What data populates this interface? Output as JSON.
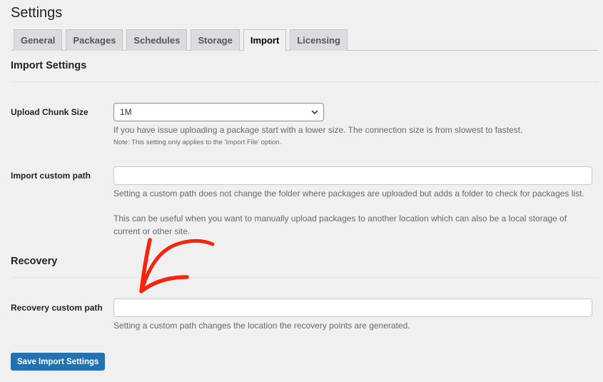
{
  "page": {
    "title": "Settings"
  },
  "tabs": [
    {
      "label": "General",
      "active": false
    },
    {
      "label": "Packages",
      "active": false
    },
    {
      "label": "Schedules",
      "active": false
    },
    {
      "label": "Storage",
      "active": false
    },
    {
      "label": "Import",
      "active": true
    },
    {
      "label": "Licensing",
      "active": false
    }
  ],
  "import_settings": {
    "heading": "Import Settings",
    "upload_chunk_size": {
      "label": "Upload Chunk Size",
      "selected": "1M",
      "description": "If you have issue uploading a package start with a lower size. The connection size is from slowest to fastest.",
      "note": "Note: This setting only applies to the 'Import File' option."
    },
    "import_custom_path": {
      "label": "Import custom path",
      "value": "",
      "description_1": "Setting a custom path does not change the folder where packages are uploaded but adds a folder to check for packages list.",
      "description_2": "This can be useful when you want to manually upload packages to another location which can also be a local storage of current or other site."
    }
  },
  "recovery": {
    "heading": "Recovery",
    "recovery_custom_path": {
      "label": "Recovery custom path",
      "value": "",
      "description": "Setting a custom path changes the location the recovery points are generated."
    }
  },
  "actions": {
    "save_label": "Save Import Settings"
  },
  "annotation": {
    "type": "arrow-icon",
    "color": "#f5250d",
    "points_to": "recovery-custom-path-input"
  },
  "colors": {
    "primary": "#2271b1",
    "background": "#f0f0f1"
  }
}
